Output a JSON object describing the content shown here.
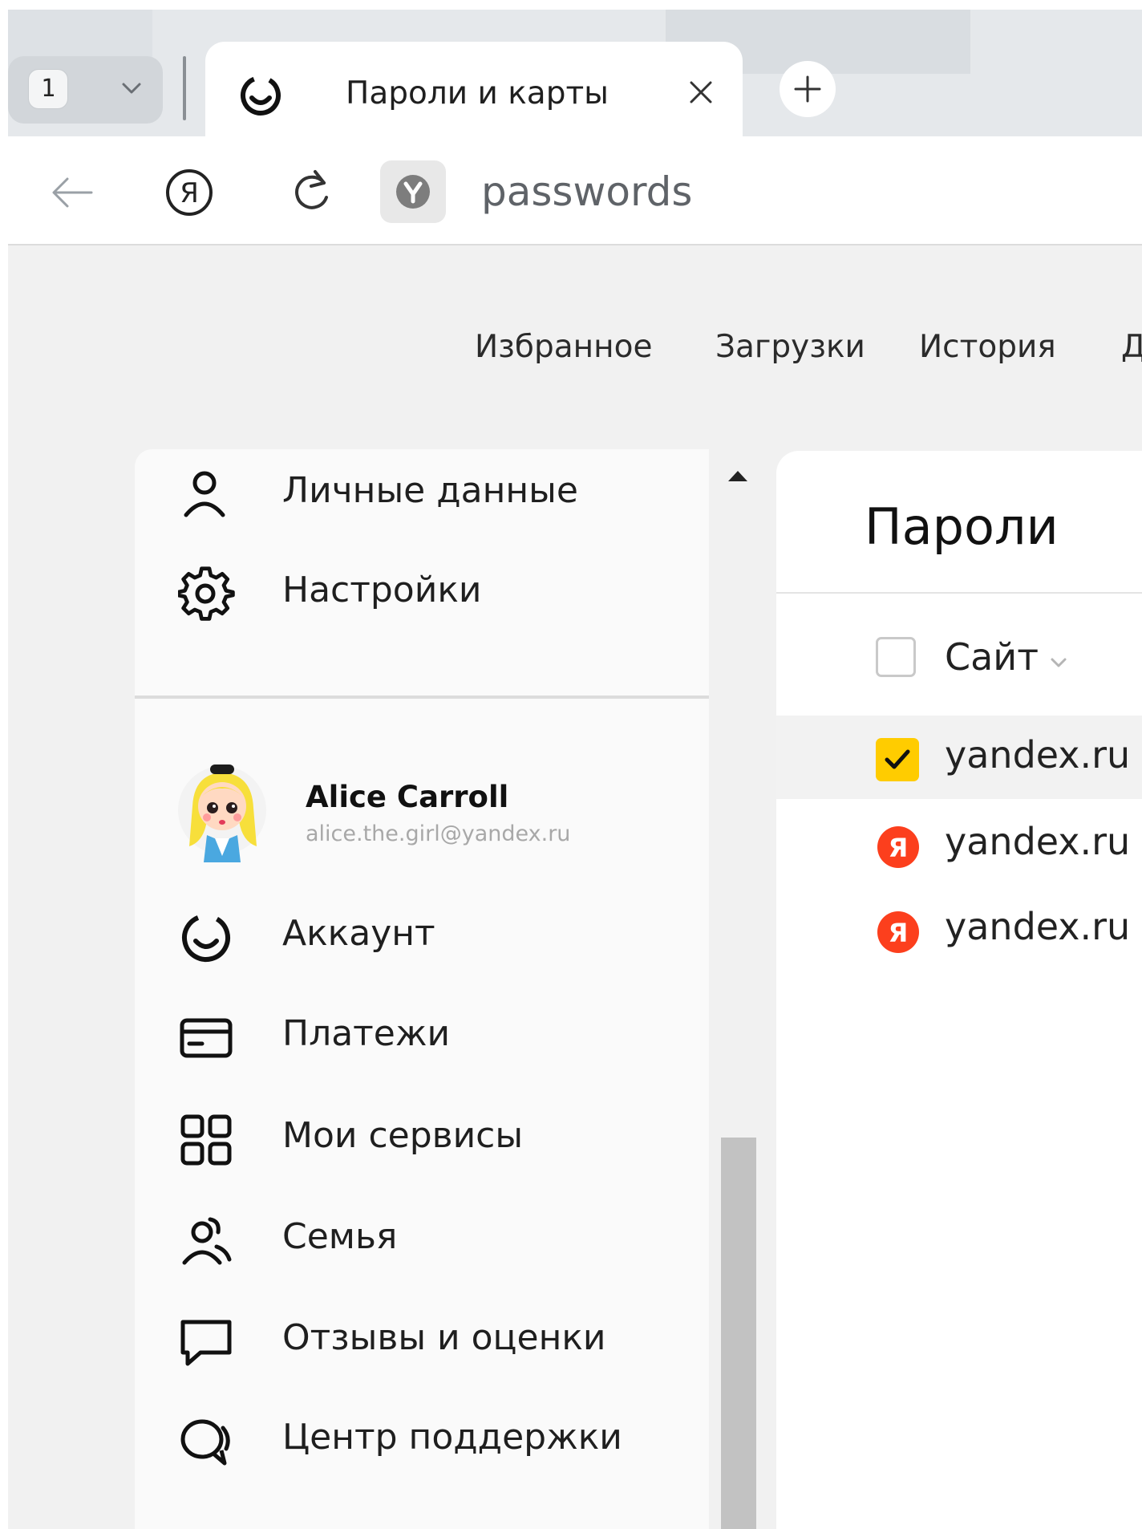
{
  "browser": {
    "tab_count": "1",
    "active_tab_title": "Пароли и карты",
    "address": "passwords"
  },
  "topnav": {
    "items": [
      "Избранное",
      "Загрузки",
      "История",
      "Д"
    ]
  },
  "sidebar": {
    "top_items": [
      {
        "label": "Личные данные",
        "icon": "person-icon"
      },
      {
        "label": "Настройки",
        "icon": "gear-icon"
      }
    ],
    "profile": {
      "name": "Alice Carroll",
      "email": "alice.the.girl@yandex.ru"
    },
    "items": [
      {
        "label": "Аккаунт",
        "icon": "yandex-id-icon"
      },
      {
        "label": "Платежи",
        "icon": "card-icon"
      },
      {
        "label": "Мои сервисы",
        "icon": "grid-icon"
      },
      {
        "label": "Семья",
        "icon": "family-icon"
      },
      {
        "label": "Отзывы и оценки",
        "icon": "chat-icon"
      },
      {
        "label": "Центр поддержки",
        "icon": "support-icon"
      }
    ]
  },
  "main": {
    "title": "Пароли",
    "column_site": "Сайт",
    "rows": [
      {
        "site": "yandex.ru",
        "selected": true
      },
      {
        "site": "yandex.ru",
        "selected": false
      },
      {
        "site": "yandex.ru",
        "selected": false
      }
    ]
  },
  "colors": {
    "accent_yellow": "#ffcc00",
    "yandex_red": "#fc3f1d"
  }
}
